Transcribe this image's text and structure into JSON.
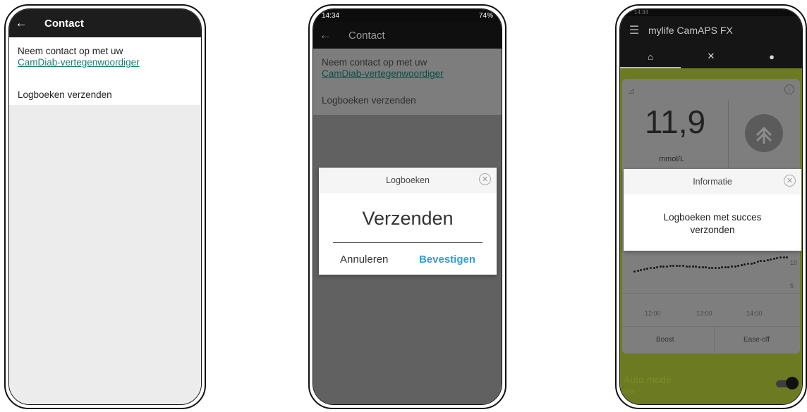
{
  "phone1": {
    "appbar_title": "Contact",
    "contact_line1": "Neem contact op met uw",
    "contact_link": "CamDiab-vertegenwoordiger",
    "logbook_item": "Logboeken verzenden"
  },
  "phone2": {
    "status_time": "14:34",
    "status_battery": "74%",
    "appbar_title": "Contact",
    "contact_line1": "Neem contact op met uw",
    "contact_link": "CamDiab-vertegenwoordiger",
    "logbook_item": "Logboeken verzenden",
    "dialog": {
      "title": "Logboeken",
      "heading": "Verzenden",
      "cancel_label": "Annuleren",
      "confirm_label": "Bevestigen"
    }
  },
  "phone3": {
    "status_time": "14:34",
    "appbar_title": "mylife CamAPS FX",
    "tabs": [
      "home-icon",
      "tools-icon",
      "drop-icon"
    ],
    "glucose_value": "11,9",
    "glucose_unit": "mmol/L",
    "x_ticks": [
      "12:00",
      "13:00",
      "14:00"
    ],
    "y_ticks": [
      "10",
      "5"
    ],
    "boost_label": "Boost",
    "easeoff_label": "Ease-off",
    "auto_mode_label": "Auto mode",
    "auto_mode_sub": "Aan",
    "dialog": {
      "title": "Informatie",
      "message_line1": "Logboeken met succes",
      "message_line2": "verzonden"
    }
  },
  "colors": {
    "link": "#1a7e74",
    "confirm": "#2f9fd8",
    "camaps_green": "#6c7a22"
  }
}
